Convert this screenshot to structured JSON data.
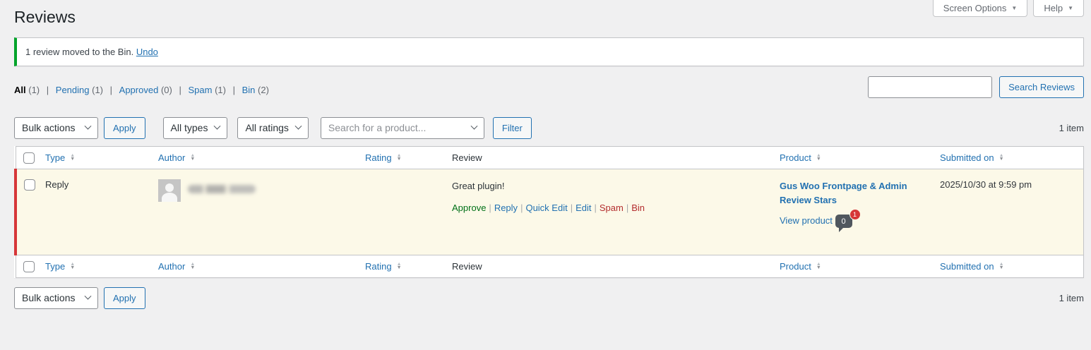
{
  "colors": {
    "accent_blue": "#2271b1",
    "notice_green": "#00a32a",
    "unapproved_row_bg": "#fcf9e8",
    "unapproved_stripe_red": "#d63638",
    "approve_link_green": "#007017",
    "spam_bin_link_red": "#b32d2e",
    "page_bg": "#f0f0f1"
  },
  "icons": {
    "caret_down": "▼",
    "sort_up": "▲",
    "sort_down": "▼",
    "pipe": "|"
  },
  "page": {
    "title": "Reviews"
  },
  "top_tabs": {
    "screen_options_label": "Screen Options",
    "help_label": "Help"
  },
  "notice": {
    "message": "1 review moved to the Bin.",
    "undo_label": "Undo"
  },
  "status_filters": [
    {
      "label": "All",
      "count": "(1)"
    },
    {
      "label": "Pending",
      "count": "(1)"
    },
    {
      "label": "Approved",
      "count": "(0)"
    },
    {
      "label": "Spam",
      "count": "(1)"
    },
    {
      "label": "Bin",
      "count": "(2)"
    }
  ],
  "search": {
    "input_value": "",
    "button_label": "Search Reviews"
  },
  "toolbar": {
    "bulk_actions_label": "Bulk actions",
    "apply_label": "Apply",
    "types_label": "All types",
    "ratings_label": "All ratings",
    "product_search_placeholder": "Search for a product...",
    "filter_label": "Filter",
    "item_count": "1 item"
  },
  "table": {
    "headers": {
      "type": "Type",
      "author": "Author",
      "rating": "Rating",
      "review": "Review",
      "product": "Product",
      "submitted_on": "Submitted on"
    },
    "row": {
      "type": "Reply",
      "review_text": "Great plugin!",
      "actions": [
        {
          "label": "Approve"
        },
        {
          "label": "Reply"
        },
        {
          "label": "Quick Edit"
        },
        {
          "label": "Edit"
        },
        {
          "label": "Spam"
        },
        {
          "label": "Bin"
        }
      ],
      "product_name": "Gus Woo Frontpage & Admin Review Stars",
      "view_product_label": "View product",
      "comment_count": "0",
      "pending_count": "1",
      "submitted_on": "2025/10/30 at 9:59 pm"
    }
  }
}
